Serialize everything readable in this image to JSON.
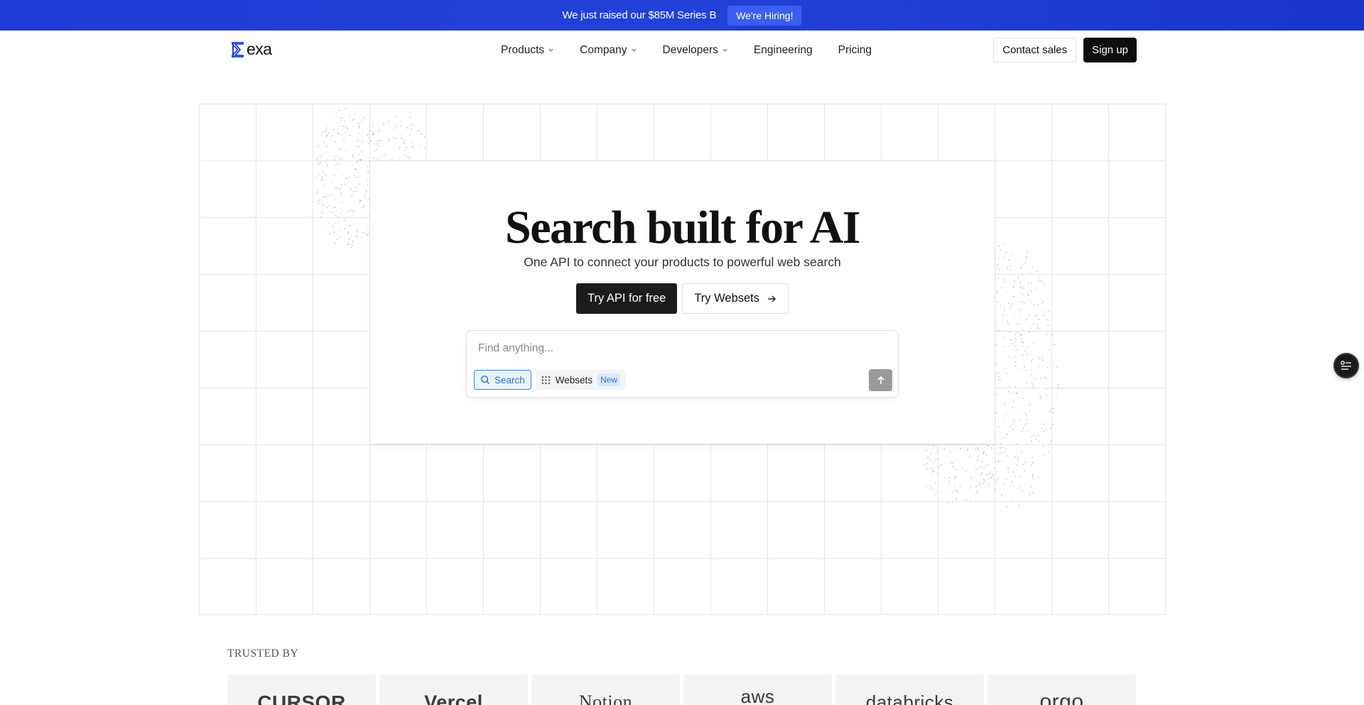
{
  "announcement": {
    "text": "We just raised our $85M Series B",
    "button_label": "We're Hiring!"
  },
  "nav": {
    "logo_text": "exa",
    "links": [
      {
        "label": "Products",
        "dropdown": true
      },
      {
        "label": "Company",
        "dropdown": true
      },
      {
        "label": "Developers",
        "dropdown": true
      },
      {
        "label": "Engineering",
        "dropdown": false
      },
      {
        "label": "Pricing",
        "dropdown": false
      }
    ],
    "contact_label": "Contact sales",
    "signup_label": "Sign up"
  },
  "hero": {
    "title": "Search built for AI",
    "subtitle": "One API to connect your products to powerful web search",
    "primary_cta": "Try API for free",
    "secondary_cta": "Try Websets"
  },
  "search": {
    "placeholder": "Find anything...",
    "modes": [
      {
        "label": "Search",
        "active": true
      },
      {
        "label": "Websets",
        "badge": "New",
        "active": false
      }
    ]
  },
  "trusted": {
    "label": "TRUSTED BY",
    "logos": [
      "CURSOR",
      "Vercel",
      "Notion",
      "aws",
      "databricks",
      "orgo"
    ]
  },
  "colors": {
    "announcement_bg": "#1f3ad6",
    "accent_blue": "#2c6fc5",
    "dark": "#0d0d0d"
  }
}
